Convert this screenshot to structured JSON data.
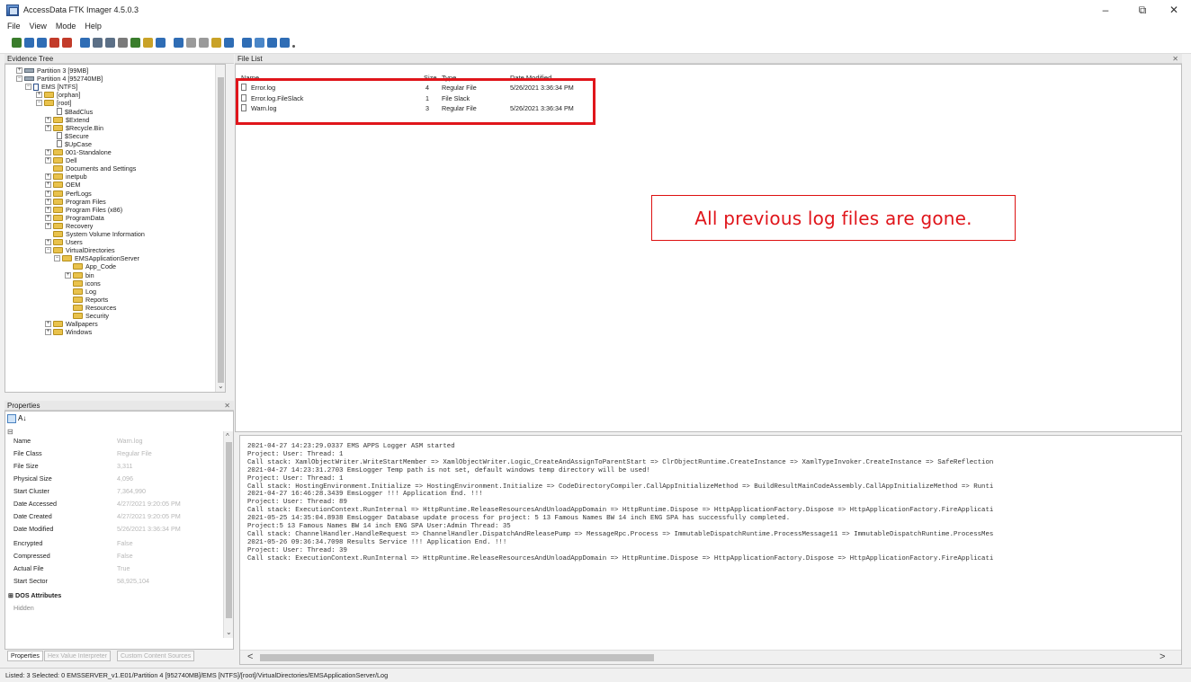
{
  "window": {
    "title": "AccessData FTK Imager 4.5.0.3",
    "minimize": "–",
    "maximize": "⧉",
    "close": "✕"
  },
  "menu": [
    "File",
    "View",
    "Mode",
    "Help"
  ],
  "toolbar": {
    "icons": [
      "add-evidence-icon",
      "add-all-icon",
      "image-mounting-icon",
      "remove-evidence-icon",
      "remove-all-icon",
      "create-image-icon",
      "export-disk-image-icon",
      "export-logical-image-icon",
      "capture-memory-icon",
      "obtain-protected-files-icon",
      "detect-encryption-icon",
      "export-files-icon",
      "export-file-hash-icon",
      "add-custom-content-icon",
      "create-custom-image-icon",
      "decrypt-icon",
      "view-files-icon",
      "text-view-icon",
      "hex-view-icon",
      "auto-view-icon",
      "help-icon",
      "dot-icon"
    ]
  },
  "evidence_tree": {
    "title": "Evidence Tree",
    "items": [
      {
        "label": "Partition 3 [99MB]",
        "icon": "drive",
        "exp": "+"
      },
      {
        "label": "Partition 4 [952740MB]",
        "icon": "drive",
        "exp": "-"
      },
      {
        "label": "EMS [NTFS]",
        "icon": "ntfs",
        "exp": "-"
      },
      {
        "label": "[orphan]",
        "icon": "folder",
        "exp": "+"
      },
      {
        "label": "[root]",
        "icon": "folder",
        "exp": "-"
      },
      {
        "label": "$BadClus",
        "icon": "file",
        "exp": ""
      },
      {
        "label": "$Extend",
        "icon": "folder",
        "exp": "+"
      },
      {
        "label": "$Recycle.Bin",
        "icon": "folder",
        "exp": "+"
      },
      {
        "label": "$Secure",
        "icon": "file",
        "exp": ""
      },
      {
        "label": "$UpCase",
        "icon": "file",
        "exp": ""
      },
      {
        "label": "001-Standalone",
        "icon": "folder",
        "exp": "+"
      },
      {
        "label": "Dell",
        "icon": "folder",
        "exp": "+"
      },
      {
        "label": "Documents and Settings",
        "icon": "folder",
        "exp": ""
      },
      {
        "label": "inetpub",
        "icon": "folder",
        "exp": "+"
      },
      {
        "label": "OEM",
        "icon": "folder",
        "exp": "+"
      },
      {
        "label": "PerfLogs",
        "icon": "folder",
        "exp": "+"
      },
      {
        "label": "Program Files",
        "icon": "folder",
        "exp": "+"
      },
      {
        "label": "Program Files (x86)",
        "icon": "folder",
        "exp": "+"
      },
      {
        "label": "ProgramData",
        "icon": "folder",
        "exp": "+"
      },
      {
        "label": "Recovery",
        "icon": "folder",
        "exp": "+"
      },
      {
        "label": "System Volume Information",
        "icon": "folder",
        "exp": ""
      },
      {
        "label": "Users",
        "icon": "folder",
        "exp": "+"
      },
      {
        "label": "VirtualDirectories",
        "icon": "folder",
        "exp": "-"
      },
      {
        "label": "EMSApplicationServer",
        "icon": "folder",
        "exp": "-"
      },
      {
        "label": "App_Code",
        "icon": "folder",
        "exp": ""
      },
      {
        "label": "bin",
        "icon": "folder",
        "exp": "+"
      },
      {
        "label": "icons",
        "icon": "folder",
        "exp": ""
      },
      {
        "label": "Log",
        "icon": "folder",
        "exp": ""
      },
      {
        "label": "Reports",
        "icon": "folder",
        "exp": ""
      },
      {
        "label": "Resources",
        "icon": "folder",
        "exp": ""
      },
      {
        "label": "Security",
        "icon": "folder",
        "exp": ""
      },
      {
        "label": "Wallpapers",
        "icon": "folder",
        "exp": "+"
      },
      {
        "label": "Windows",
        "icon": "folder",
        "exp": "+"
      }
    ]
  },
  "properties": {
    "title": "Properties",
    "sort_label": "A↓",
    "rows": [
      {
        "name": "Name",
        "value": "Warn.log"
      },
      {
        "name": "File Class",
        "value": "Regular File"
      },
      {
        "name": "File Size",
        "value": "3,311"
      },
      {
        "name": "Physical Size",
        "value": "4,096"
      },
      {
        "name": "Start Cluster",
        "value": "7,364,990"
      },
      {
        "name": "Date Accessed",
        "value": "4/27/2021 9:20:05 PM"
      },
      {
        "name": "Date Created",
        "value": "4/27/2021 9:20:05 PM"
      },
      {
        "name": "Date Modified",
        "value": "5/26/2021 3:36:34 PM"
      },
      {
        "name": "Encrypted",
        "value": "False"
      },
      {
        "name": "Compressed",
        "value": "False"
      },
      {
        "name": "Actual File",
        "value": "True"
      },
      {
        "name": "Start Sector",
        "value": "58,925,104"
      }
    ],
    "section": "DOS Attributes",
    "last_row": "Hidden",
    "tabs": [
      "Properties",
      "Hex Value Interpreter",
      "Custom Content Sources"
    ]
  },
  "file_list": {
    "title": "File List",
    "columns": [
      "Name",
      "Size",
      "Type",
      "Date Modified"
    ],
    "rows": [
      {
        "name": "Error.log",
        "size": "4",
        "type": "Regular File",
        "modified": "5/26/2021 3:36:34 PM"
      },
      {
        "name": "Error.log.FileSlack",
        "size": "1",
        "type": "File Slack",
        "modified": ""
      },
      {
        "name": "Warn.log",
        "size": "3",
        "type": "Regular File",
        "modified": "5/26/2021 3:36:34 PM"
      }
    ]
  },
  "callout": "All previous log files are gone.",
  "log_lines": [
    "2021-04-27 14:23:29.0337 EMS APPS Logger ASM started",
    " Project: User: Thread: 1",
    " Call stack: XamlObjectWriter.WriteStartMember => XamlObjectWriter.Logic_CreateAndAssignToParentStart => ClrObjectRuntime.CreateInstance => XamlTypeInvoker.CreateInstance => SafeReflection",
    "2021-04-27 14:23:31.2703 EmsLogger Temp path is not set, default windows temp directory will be used!",
    " Project: User: Thread: 1",
    " Call stack: HostingEnvironment.Initialize => HostingEnvironment.Initialize => CodeDirectoryCompiler.CallAppInitializeMethod => BuildResultMainCodeAssembly.CallAppInitializeMethod => Runti",
    "2021-04-27 16:46:28.3439 EmsLogger !!! Application End. !!!",
    " Project: User: Thread: 89",
    " Call stack: ExecutionContext.RunInternal => HttpRuntime.ReleaseResourcesAndUnloadAppDomain => HttpRuntime.Dispose => HttpApplicationFactory.Dispose => HttpApplicationFactory.FireApplicati",
    "2021-05-25 14:35:04.8938 EmsLogger Database update process for project: 5 13 Famous Names BW 14 inch ENG SPA has successfully completed.",
    " Project:5 13 Famous Names BW 14 inch ENG SPA User:Admin Thread: 35",
    " Call stack: ChannelHandler.HandleRequest => ChannelHandler.DispatchAndReleasePump => MessageRpc.Process => ImmutableDispatchRuntime.ProcessMessage11 => ImmutableDispatchRuntime.ProcessMes",
    "2021-05-26 09:36:34.7098 Results Service !!! Application End. !!!",
    " Project: User: Thread: 39",
    " Call stack: ExecutionContext.RunInternal => HttpRuntime.ReleaseResourcesAndUnloadAppDomain => HttpRuntime.Dispose => HttpApplicationFactory.Dispose => HttpApplicationFactory.FireApplicati"
  ],
  "scroll_arrows": {
    "left": "<",
    "right": ">",
    "down": "⌄",
    "up": "^"
  },
  "status": "Listed: 3  Selected: 0   EMSSERVER_v1.E01/Partition 4 [952740MB]/EMS [NTFS]/[root]/VirtualDirectories/EMSApplicationServer/Log",
  "colors": {
    "highlight": "#e0151b",
    "folder": "#e9c24c"
  }
}
